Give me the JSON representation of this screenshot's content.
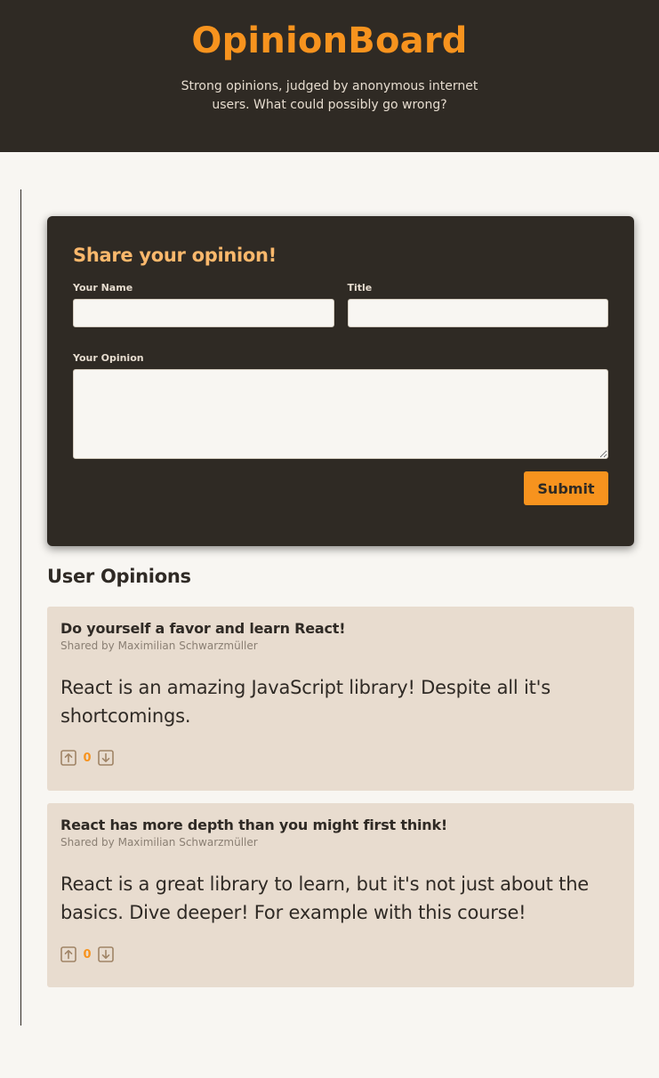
{
  "header": {
    "title": "OpinionBoard",
    "subtitle": "Strong opinions, judged by anonymous internet users. What could possibly go wrong?"
  },
  "form": {
    "heading": "Share your opinion!",
    "name_label": "Your Name",
    "name_value": "",
    "title_label": "Title",
    "title_value": "",
    "opinion_label": "Your Opinion",
    "opinion_value": "",
    "submit_label": "Submit"
  },
  "opinions_section": {
    "title": "User Opinions",
    "items": [
      {
        "title": "Do yourself a favor and learn React!",
        "author": "Shared by Maximilian Schwarzmüller",
        "body": "React is an amazing JavaScript library! Despite all it's shortcomings.",
        "votes": "0"
      },
      {
        "title": "React has more depth than you might first think!",
        "author": "Shared by Maximilian Schwarzmüller",
        "body": "React is a great library to learn, but it's not just about the basics. Dive deeper! For example with this course!",
        "votes": "0"
      }
    ]
  },
  "colors": {
    "accent": "#f7931e",
    "dark": "#2f2a24",
    "card": "#e8dccf",
    "background": "#f8f6f2"
  },
  "icons": {
    "upvote": "arrow-up-square-icon",
    "downvote": "arrow-down-square-icon"
  }
}
